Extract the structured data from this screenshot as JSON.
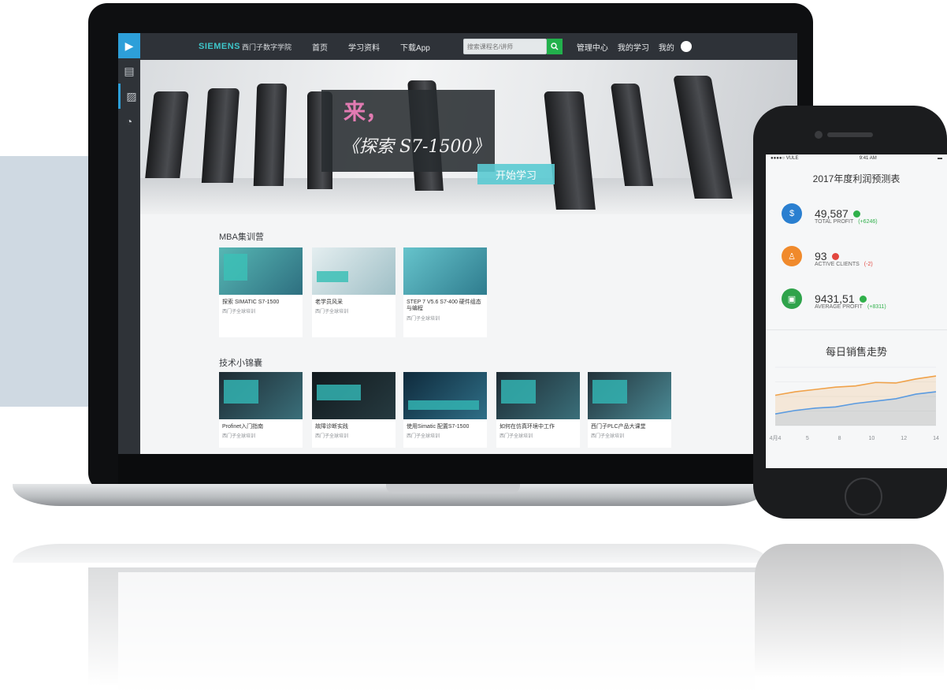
{
  "web_app": {
    "brand": "SIEMENS",
    "brand_sub": "西门子数字学院",
    "nav": [
      "首页",
      "学习资料",
      "下载App"
    ],
    "search_placeholder": "搜索课程名/讲师",
    "nav_right": [
      "管理中心",
      "我的学习",
      "我的"
    ],
    "sidebar_icons": [
      "play-icon",
      "document-icon",
      "image-icon",
      "dashboard-icon"
    ],
    "banner": {
      "line1": "来，",
      "line2": "《探索 S7-1500》",
      "cta": "开始学习"
    },
    "section1": {
      "title": "MBA集训营",
      "cards": [
        {
          "title": "探索 SIMATIC S7-1500",
          "subtitle": "西门子全球培训",
          "thumb_color": "#3fa8b0"
        },
        {
          "title": "老学员风采",
          "subtitle": "西门子全球培训",
          "thumb_color": "#c9d8dc"
        },
        {
          "title": "STEP 7 V5.6 S7-400 硬件组态与编程",
          "subtitle": "西门子全球培训",
          "thumb_color": "#4bb3bd"
        }
      ]
    },
    "section2": {
      "title": "技术小锦囊",
      "cards": [
        {
          "title": "Profinet入门指南",
          "subtitle": "西门子全球培训"
        },
        {
          "title": "故障诊断实践",
          "subtitle": "西门子全球培训"
        },
        {
          "title": "使用Simatic 配置S7-1500",
          "subtitle": "西门子全球培训"
        },
        {
          "title": "如何在仿真环境中工作",
          "subtitle": "西门子全球培训"
        },
        {
          "title": "西门子PLC产品大课堂",
          "subtitle": "西门子全球培训"
        }
      ]
    }
  },
  "mobile_app": {
    "status_left": "●●●●○ VULE",
    "status_center": "9:41 AM",
    "title": "2017年度利润预测表",
    "stats": [
      {
        "value": "49,587",
        "label": "TOTAL PROFIT",
        "delta": "(+6246)",
        "icon": "dollar-icon",
        "icon_color": "#2a7fd0",
        "trend_color": "#2fb04a",
        "delta_color": "#2fb04a"
      },
      {
        "value": "93",
        "label": "ACTIVE CLIENTS",
        "delta": "(-2)",
        "icon": "user-icon",
        "icon_color": "#f08a2c",
        "trend_color": "#e2473f",
        "delta_color": "#e2473f"
      },
      {
        "value": "9431,51",
        "label": "AVERAGE PROFIT",
        "delta": "(+8311)",
        "icon": "wallet-icon",
        "icon_color": "#2fa34b",
        "trend_color": "#2fb04a",
        "delta_color": "#2fb04a"
      }
    ],
    "chart_title": "每日销售走势"
  },
  "chart_data": {
    "type": "area",
    "title": "每日销售走势",
    "x": [
      "4月4",
      "5",
      "8",
      "10",
      "12",
      "14"
    ],
    "xlabel": "",
    "ylabel": "",
    "ylim": [
      0,
      100
    ],
    "grid": true,
    "series": [
      {
        "name": "",
        "color": "#f0a24a",
        "values": [
          52,
          58,
          62,
          66,
          68,
          74,
          73,
          80,
          85
        ]
      },
      {
        "name": "",
        "color": "#5b9be0",
        "values": [
          20,
          26,
          30,
          32,
          38,
          42,
          46,
          54,
          58
        ]
      }
    ]
  }
}
